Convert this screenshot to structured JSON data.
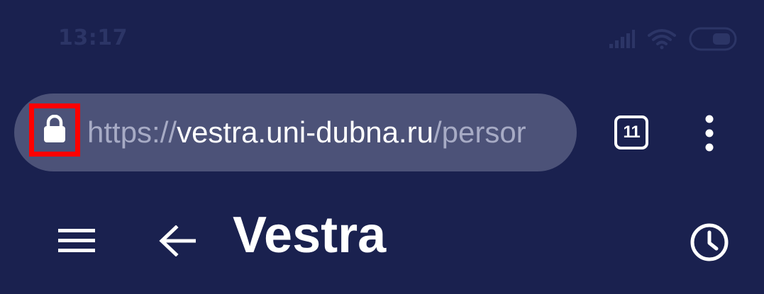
{
  "status_bar": {
    "time": "13:17",
    "icons": [
      "signal-icon",
      "wifi-icon",
      "battery-icon"
    ]
  },
  "browser": {
    "url": {
      "scheme": "https://",
      "host": "vestra.uni-dubna.ru",
      "path": "/persor"
    },
    "tab_count": "11",
    "icons": [
      "lock-icon",
      "tabs-icon",
      "overflow-menu-icon"
    ]
  },
  "app_bar": {
    "title": "Vestra",
    "icons": [
      "menu-icon",
      "back-arrow-icon",
      "history-icon"
    ]
  },
  "colors": {
    "background": "#1a214f",
    "omnibox": "#4c5278",
    "highlight": "#ff0000",
    "url_muted": "#a7abc5",
    "foreground": "#ffffff"
  }
}
